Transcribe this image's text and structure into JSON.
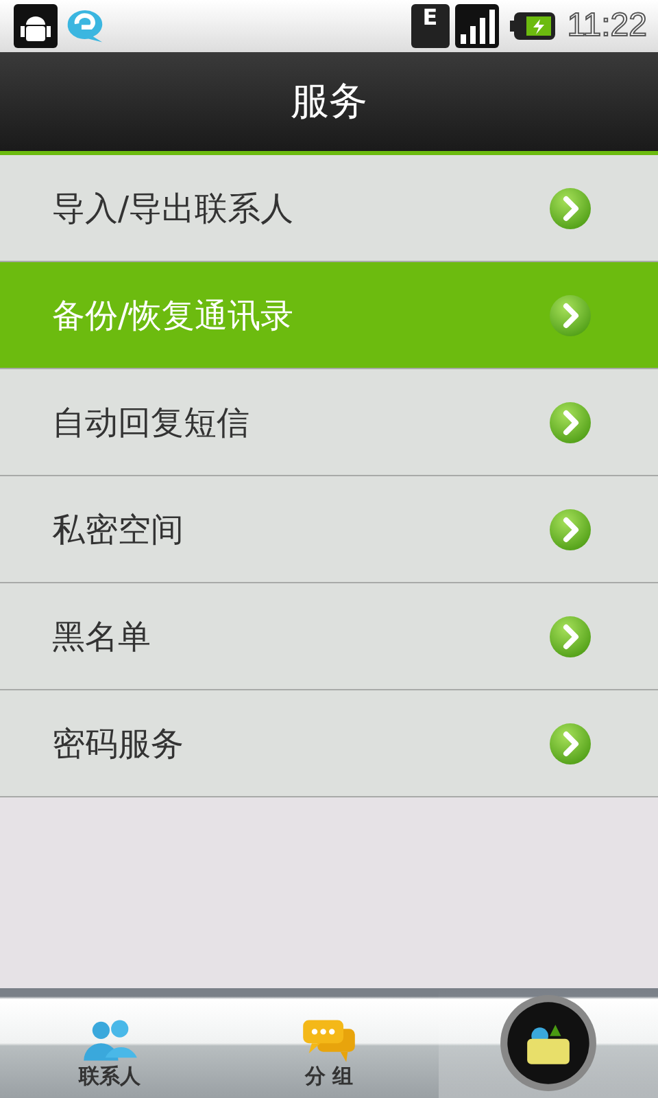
{
  "status_bar": {
    "time": "11:22",
    "network": "E"
  },
  "header": {
    "title": "服务"
  },
  "menu": [
    {
      "label": "导入/导出联系人",
      "selected": false
    },
    {
      "label": "备份/恢复通讯录",
      "selected": true
    },
    {
      "label": "自动回复短信",
      "selected": false
    },
    {
      "label": "私密空间",
      "selected": false
    },
    {
      "label": "黑名单",
      "selected": false
    },
    {
      "label": "密码服务",
      "selected": false
    }
  ],
  "tabs": [
    {
      "kind": "contacts",
      "label": "联系人",
      "selected": false
    },
    {
      "kind": "groups",
      "label": "分 组",
      "selected": false
    },
    {
      "kind": "services",
      "selected": true
    }
  ]
}
